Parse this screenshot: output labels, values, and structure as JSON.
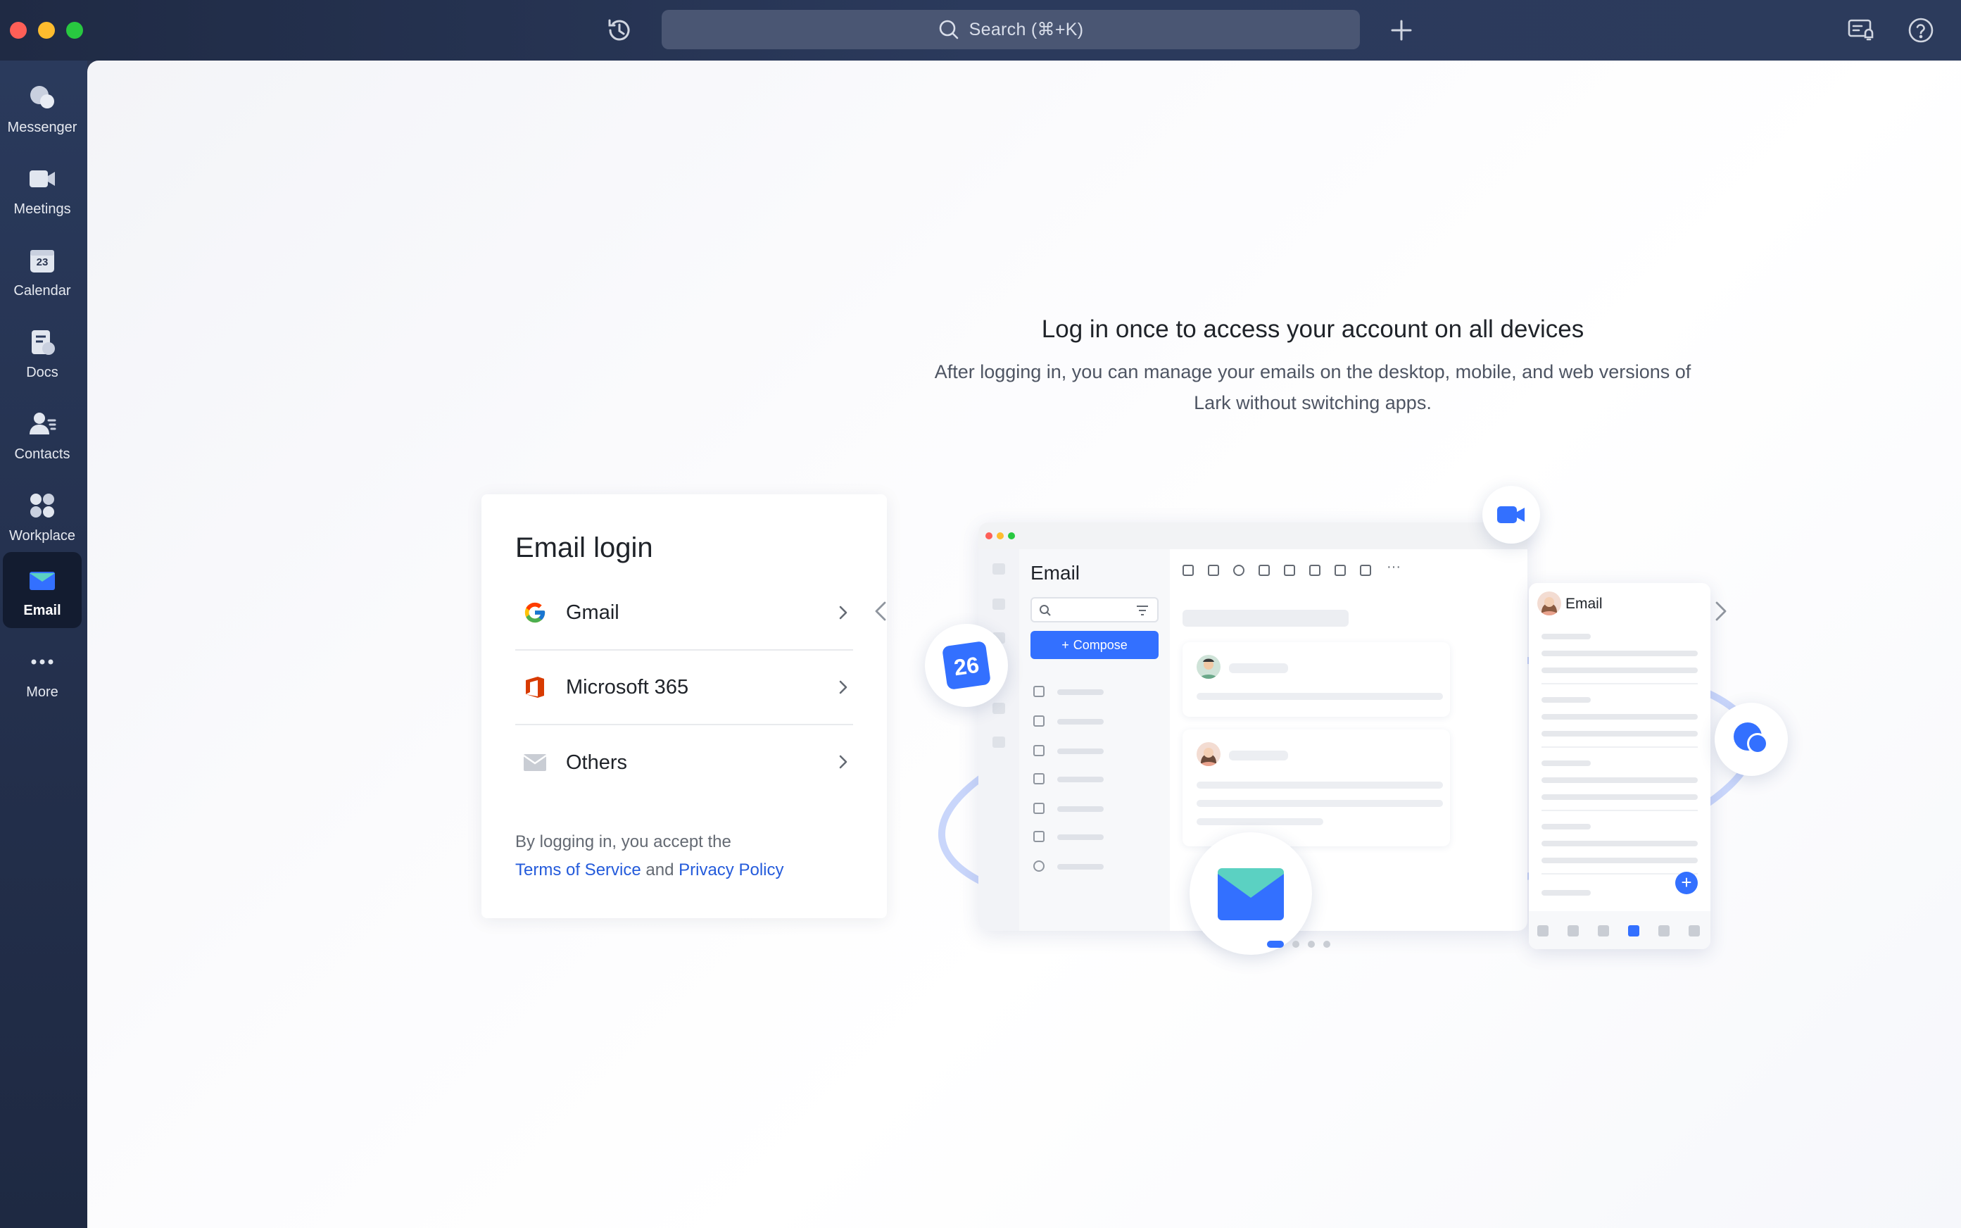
{
  "titlebar": {
    "search_placeholder": "Search (⌘+K)",
    "icons": [
      "history-icon",
      "plus-icon",
      "screen-notification-icon",
      "help-icon"
    ]
  },
  "sidebar": {
    "items": [
      {
        "label": "Messenger",
        "icon": "messenger-icon"
      },
      {
        "label": "Meetings",
        "icon": "video-camera-icon"
      },
      {
        "label": "Calendar",
        "icon": "calendar-icon",
        "icon_text": "23"
      },
      {
        "label": "Docs",
        "icon": "docs-icon"
      },
      {
        "label": "Contacts",
        "icon": "contacts-icon"
      },
      {
        "label": "Workplace",
        "icon": "workplace-icon"
      },
      {
        "label": "Email",
        "icon": "email-icon",
        "active": true
      },
      {
        "label": "More",
        "icon": "more-icon"
      }
    ]
  },
  "login": {
    "title": "Email login",
    "providers": [
      {
        "name": "Gmail",
        "icon": "google-icon"
      },
      {
        "name": "Microsoft 365",
        "icon": "office-icon"
      },
      {
        "name": "Others",
        "icon": "envelope-icon"
      }
    ],
    "terms_prefix": "By logging in, you accept the",
    "terms_link": "Terms of Service",
    "terms_and": "and",
    "privacy_link": "Privacy Policy"
  },
  "promo": {
    "title": "Log in once to access your account on all devices",
    "subtitle_line1": "After logging in, you can manage your emails on the desktop, mobile, and web versions of",
    "subtitle_line2": "Lark without switching apps.",
    "slides_total": 4,
    "active_slide": 1
  },
  "illustration": {
    "window_title": "Email",
    "compose_label": "Compose",
    "mobile_title": "Email",
    "calendar_day": "26"
  },
  "colors": {
    "accent": "#3370ff",
    "link": "#245bdb",
    "sidebar_bg": "#232f4b",
    "titlebar_bg": "#2b3a5c"
  }
}
